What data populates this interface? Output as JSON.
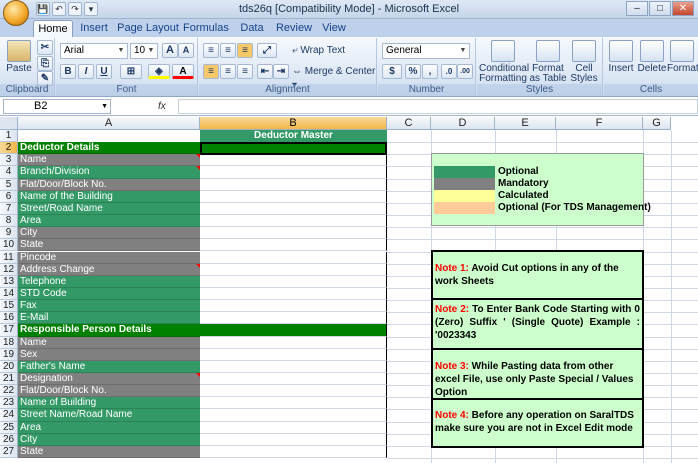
{
  "window": {
    "title": "tds26q  [Compatibility Mode] - Microsoft Excel",
    "controls": [
      "–",
      "□",
      "✕"
    ]
  },
  "qat": [
    "💾",
    "↶",
    "↷",
    "▾"
  ],
  "tabs": [
    "Home",
    "Insert",
    "Page Layout",
    "Formulas",
    "Data",
    "Review",
    "View"
  ],
  "active_tab": "Home",
  "ribbon": {
    "clipboard": {
      "label": "Clipboard",
      "paste": "Paste"
    },
    "font": {
      "label": "Font",
      "name": "Arial",
      "size": "10",
      "bold": "B",
      "italic": "I",
      "underline": "U",
      "grow": "A",
      "shrink": "A",
      "fill": "A"
    },
    "alignment": {
      "label": "Alignment",
      "wrap": "Wrap Text",
      "merge": "Merge & Center"
    },
    "number": {
      "label": "Number",
      "format": "General",
      "currency": "$",
      "percent": "%",
      "comma": ",",
      "inc": ".0",
      "dec": ".00"
    },
    "styles": {
      "label": "Styles",
      "conditional": "Conditional",
      "conditional2": "Formatting",
      "format_table": "Format",
      "format_table2": "as Table",
      "cell_styles": "Cell",
      "cell_styles2": "Styles"
    },
    "cells": {
      "label": "Cells",
      "insert": "Insert",
      "delete": "Delete",
      "format": "Format"
    }
  },
  "formula_bar": {
    "name_box": "B2",
    "fx": "fx",
    "content": ""
  },
  "columns": [
    "A",
    "B",
    "C",
    "D",
    "E",
    "F",
    "G"
  ],
  "selected_column": "B",
  "selected_row": "2",
  "rows": [
    {
      "n": "1",
      "a": "",
      "type": "title"
    },
    {
      "n": "2",
      "a": "Deductor Details",
      "type": "section"
    },
    {
      "n": "3",
      "a": "Name",
      "type": "gray"
    },
    {
      "n": "4",
      "a": "Branch/Division",
      "type": "green"
    },
    {
      "n": "5",
      "a": "Flat/Door/Block No.",
      "type": "gray"
    },
    {
      "n": "6",
      "a": "Name of the Building",
      "type": "green"
    },
    {
      "n": "7",
      "a": "Street/Road Name",
      "type": "green"
    },
    {
      "n": "8",
      "a": "Area",
      "type": "green"
    },
    {
      "n": "9",
      "a": "City",
      "type": "gray"
    },
    {
      "n": "10",
      "a": "State",
      "type": "gray"
    },
    {
      "n": "11",
      "a": "Pincode",
      "type": "gray"
    },
    {
      "n": "12",
      "a": "Address Change",
      "type": "gray"
    },
    {
      "n": "13",
      "a": "Telephone",
      "type": "green"
    },
    {
      "n": "14",
      "a": "STD Code",
      "type": "green"
    },
    {
      "n": "15",
      "a": "Fax",
      "type": "green"
    },
    {
      "n": "16",
      "a": "E-Mail",
      "type": "green"
    },
    {
      "n": "17",
      "a": "Responsible Person Details",
      "type": "section"
    },
    {
      "n": "18",
      "a": "Name",
      "type": "gray"
    },
    {
      "n": "19",
      "a": "Sex",
      "type": "gray"
    },
    {
      "n": "20",
      "a": "Father's Name",
      "type": "green"
    },
    {
      "n": "21",
      "a": "Designation",
      "type": "gray"
    },
    {
      "n": "22",
      "a": "Flat/Door/Block No.",
      "type": "gray"
    },
    {
      "n": "23",
      "a": "Name of Building",
      "type": "green"
    },
    {
      "n": "24",
      "a": "Street Name/Road Name",
      "type": "green"
    },
    {
      "n": "25",
      "a": "Area",
      "type": "green"
    },
    {
      "n": "26",
      "a": "City",
      "type": "green"
    },
    {
      "n": "27",
      "a": "State",
      "type": "gray"
    }
  ],
  "b1_text": "Deductor Master",
  "legend": [
    {
      "color": "#339966",
      "label": "Optional"
    },
    {
      "color": "#808080",
      "label": "Mandatory"
    },
    {
      "color": "#ffff99",
      "label": "Calculated"
    },
    {
      "color": "#ffcc99",
      "label": "Optional (For TDS Management)"
    }
  ],
  "notes": [
    {
      "label": "Note 1:",
      "text": " Avoid Cut options in any of the work Sheets"
    },
    {
      "label": "Note 2:",
      "text": " To Enter Bank Code Starting with 0 (Zero) Suffix ' (Single Quote) Example : '0023343"
    },
    {
      "label": "Note 3:",
      "text": " While Pasting data from other excel File, use only Paste Special / Values Option"
    },
    {
      "label": "Note 4:",
      "text": " Before any operation on SaralTDS make sure you are not in Excel Edit mode"
    }
  ],
  "colors": {
    "green": "#339966",
    "gray": "#808080",
    "section": "#008000",
    "title": "#339966"
  }
}
